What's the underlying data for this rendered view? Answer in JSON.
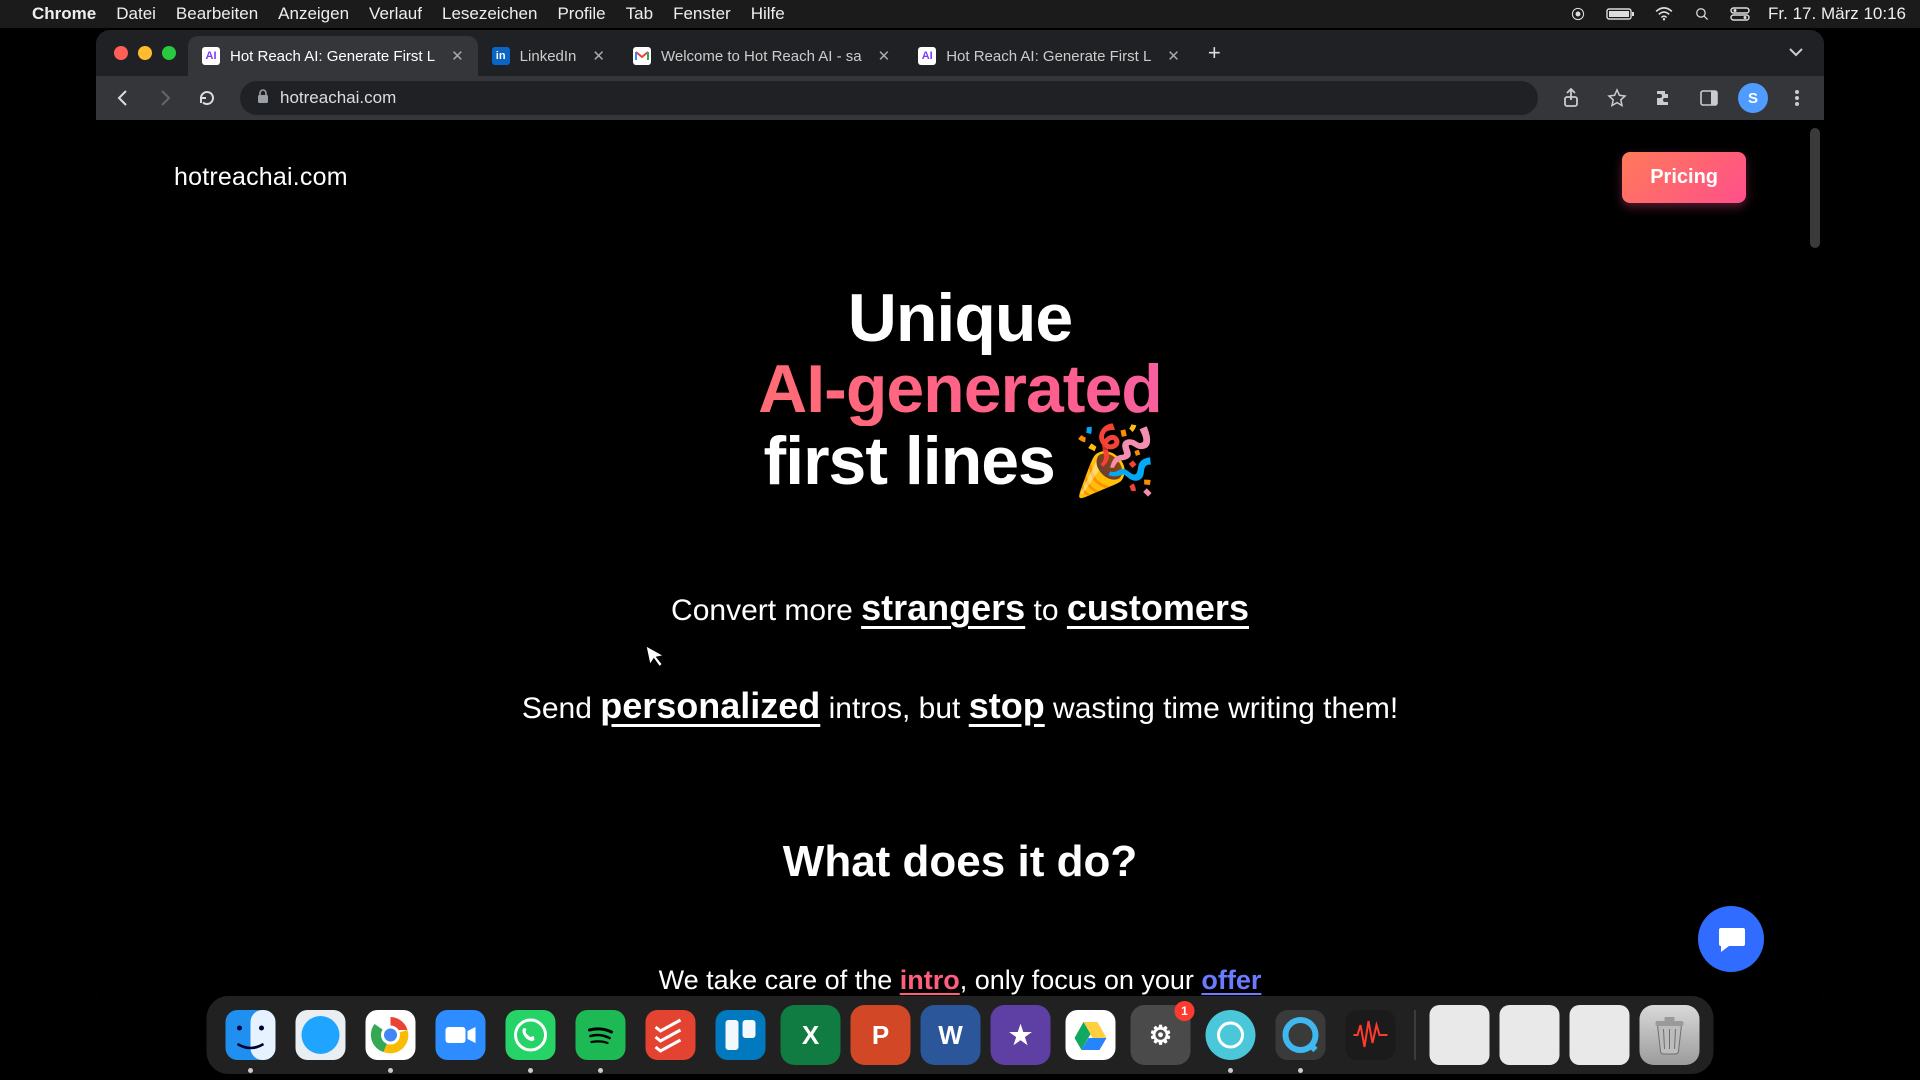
{
  "menubar": {
    "app": "Chrome",
    "items": [
      "Datei",
      "Bearbeiten",
      "Anzeigen",
      "Verlauf",
      "Lesezeichen",
      "Profile",
      "Tab",
      "Fenster",
      "Hilfe"
    ],
    "clock": "Fr. 17. März  10:16"
  },
  "browser": {
    "tabs": [
      {
        "title": "Hot Reach AI: Generate First L",
        "fav": "AI",
        "favClass": "ai",
        "active": true
      },
      {
        "title": "LinkedIn",
        "fav": "in",
        "favClass": "in",
        "active": false
      },
      {
        "title": "Welcome to Hot Reach AI - sa",
        "fav": "M",
        "favClass": "gm",
        "active": false
      },
      {
        "title": "Hot Reach AI: Generate First L",
        "fav": "AI",
        "favClass": "ai",
        "active": false
      }
    ],
    "url": "hotreachai.com",
    "avatar_initial": "S"
  },
  "page": {
    "brand": "hotreachai.com",
    "pricing": "Pricing",
    "hero_l1": "Unique",
    "hero_l2": "AI-generated",
    "hero_l3_pre": "first lines ",
    "hero_emoji": "🎉",
    "sub1_a": "Convert more ",
    "sub1_b": "strangers",
    "sub1_c": " to ",
    "sub1_d": "customers",
    "sub2_a": "Send ",
    "sub2_b": "personalized",
    "sub2_c": " intros, but ",
    "sub2_d": "stop",
    "sub2_e": " wasting time writing them!",
    "section": "What does it do?",
    "body_a": "We take care of the ",
    "body_b": "intro",
    "body_c": ", only focus on your ",
    "body_d": "offer"
  },
  "dock": {
    "apps": [
      {
        "name": "finder",
        "bg": "linear-gradient(135deg,#38b5ff,#1f7ef0)",
        "glyph": "",
        "running": true
      },
      {
        "name": "safari",
        "bg": "linear-gradient(180deg,#eef3f7,#c9d6e2)",
        "glyph": "",
        "running": false
      },
      {
        "name": "chrome",
        "bg": "#fff",
        "glyph": "",
        "running": true
      },
      {
        "name": "zoom",
        "bg": "#2d8cff",
        "glyph": "",
        "running": false
      },
      {
        "name": "whatsapp",
        "bg": "#25d366",
        "glyph": "",
        "running": true
      },
      {
        "name": "spotify",
        "bg": "#1db954",
        "glyph": "",
        "running": true
      },
      {
        "name": "todoist",
        "bg": "#e44332",
        "glyph": "",
        "running": false
      },
      {
        "name": "trello",
        "bg": "#0079bf",
        "glyph": "",
        "running": false
      },
      {
        "name": "excel",
        "bg": "#107c41",
        "glyph": "X",
        "running": false
      },
      {
        "name": "powerpoint",
        "bg": "#d24726",
        "glyph": "P",
        "running": false
      },
      {
        "name": "word",
        "bg": "#2b579a",
        "glyph": "W",
        "running": false
      },
      {
        "name": "imovie",
        "bg": "#5e3fa3",
        "glyph": "★",
        "running": false
      },
      {
        "name": "drive",
        "bg": "#fff",
        "glyph": "",
        "running": false
      },
      {
        "name": "settings",
        "bg": "#4a4a4a",
        "glyph": "⚙",
        "running": false,
        "badge": "1"
      },
      {
        "name": "app-circle",
        "bg": "#4ac7d9",
        "glyph": "",
        "running": true
      },
      {
        "name": "quicktime",
        "bg": "#3a3a3a",
        "glyph": "",
        "running": true
      },
      {
        "name": "voicememos",
        "bg": "#1b1b1b",
        "glyph": "",
        "running": false
      }
    ]
  }
}
